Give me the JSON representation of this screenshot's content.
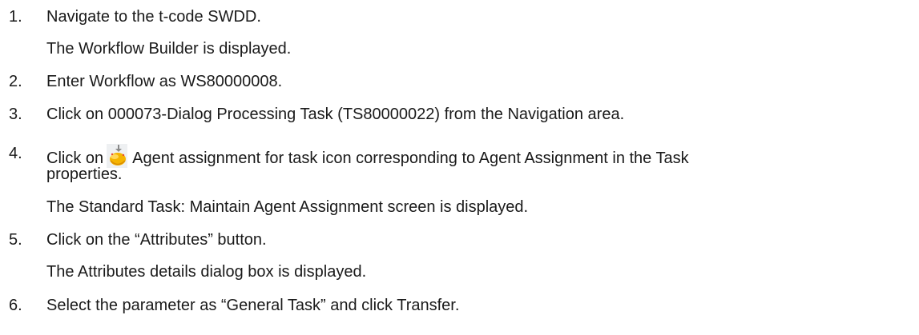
{
  "steps": [
    {
      "number": "1.",
      "text": "Navigate to the t-code SWDD."
    },
    {
      "result": "The Workflow Builder is displayed."
    },
    {
      "number": "2.",
      "text": "Enter Workflow as WS80000008."
    },
    {
      "number": "3.",
      "text": "Click on 000073-Dialog Processing Task (TS80000022) from the Navigation area."
    },
    {
      "number": "4.",
      "text_before_icon": "Click on",
      "icon": "agent-assignment-icon",
      "text_after_icon": "Agent assignment for task icon corresponding to Agent Assignment in the Task",
      "text_cont": "properties."
    },
    {
      "result": "The Standard Task: Maintain Agent Assignment screen is displayed."
    },
    {
      "number": "5.",
      "text": "Click on the “Attributes” button."
    },
    {
      "result": "The Attributes details dialog box is displayed."
    },
    {
      "number": "6.",
      "text": "Select the parameter as “General Task” and click Transfer."
    }
  ]
}
